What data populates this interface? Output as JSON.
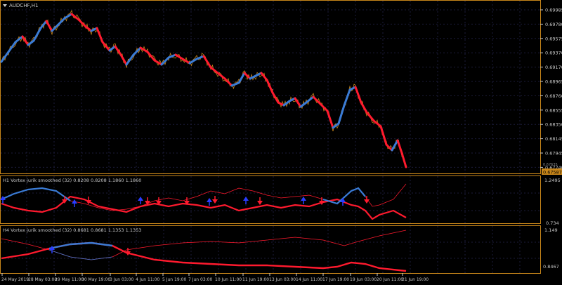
{
  "main": {
    "symbol_label": "AUDCHF,H1",
    "price_ticks": [
      "0.69985",
      "0.69780",
      "0.69575",
      "0.69370",
      "0.69170",
      "0.68965",
      "0.68760",
      "0.68555",
      "0.68350",
      "0.68145",
      "0.67945",
      "0.67740"
    ],
    "current_price": "0.67587",
    "alt_price": "0.67635"
  },
  "sub1": {
    "label": "H1 Vortex jurik smoothed (32) 0.8208 0.8208 1.1860 1.1860",
    "ticks": [
      "1.2495",
      "0.734"
    ]
  },
  "sub2": {
    "label": "H4 Vortex jurik smoothed (32) 0.8681 0.8681 1.1353 1.1353",
    "ticks": [
      "1.149",
      "0.8467"
    ]
  },
  "time_axis": [
    "24 May 2019",
    "28 May 03:00",
    "29 May 11:00",
    "30 May 19:00",
    "3 Jun 03:00",
    "4 Jun 11:00",
    "5 Jun 19:00",
    "7 Jun 03:00",
    "10 Jun 11:00",
    "11 Jun 19:00",
    "13 Jun 03:00",
    "14 Jun 11:00",
    "17 Jun 19:00",
    "19 Jun 03:00",
    "20 Jun 11:00",
    "21 Jun 19:00"
  ],
  "colors": {
    "background": "#000000",
    "grid": "#1c1c3a",
    "border": "#c8861a",
    "axis_text": "#c8c8c8",
    "bull": "#3a7bd5",
    "bear": "#ff1a2e",
    "price_line": "#c8861a",
    "arrow_up": "#2a3cff",
    "arrow_down": "#ff1a2e",
    "price_tag_bg": "#c8861a"
  }
}
